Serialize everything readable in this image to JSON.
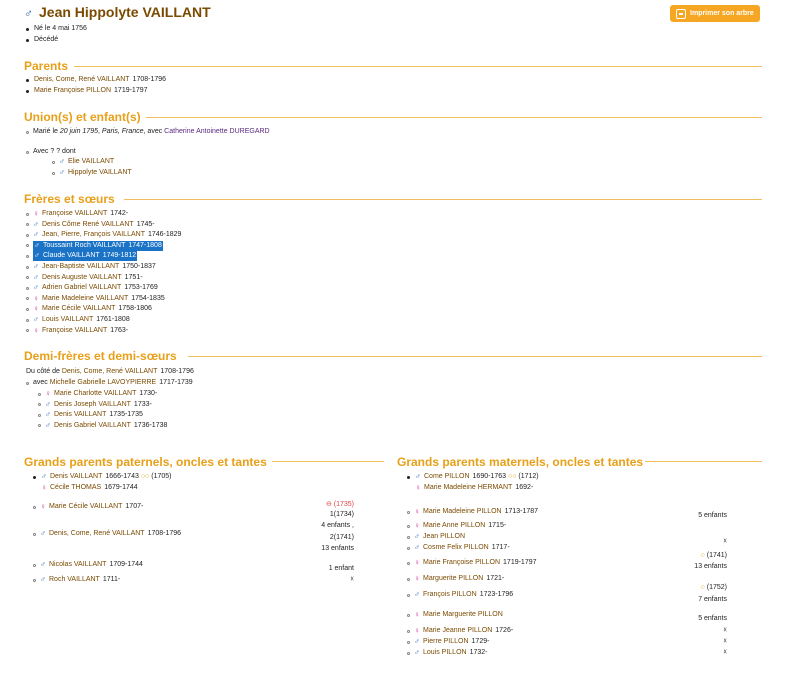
{
  "header": {
    "name": "Jean Hippolyte VAILLANT",
    "print_button": "Imprimer son arbre"
  },
  "facts": [
    "Né le 4 mai 1756",
    "Décédé"
  ],
  "parents": {
    "title": "Parents",
    "items": [
      {
        "name": "Denis, Come, René VAILLANT",
        "years": "1708-1796"
      },
      {
        "name": "Marie Françoise PILLON",
        "years": "1719-1797"
      }
    ]
  },
  "unions": {
    "title": "Union(s) et enfant(s)",
    "marriage_prefix": "Marié le",
    "marriage_date": "20 juin 1795",
    "marriage_place": "Paris, France",
    "marriage_with": ", avec",
    "spouse": "Catherine Antoinette DUREGARD",
    "other_union": "Avec ? ? dont",
    "children": [
      "Elie VAILLANT",
      "Hippolyte VAILLANT"
    ]
  },
  "siblings": {
    "title": "Frères et sœurs",
    "items": [
      {
        "sex": "f",
        "name": "Françoise VAILLANT",
        "years": "1742-"
      },
      {
        "sex": "m",
        "name": "Denis Côme René VAILLANT",
        "years": "1745-"
      },
      {
        "sex": "m",
        "name": "Jean, Pierre, François VAILLANT",
        "years": "1746-1829"
      },
      {
        "sex": "m",
        "name": "Toussaint Roch VAILLANT",
        "years": "1747-1808"
      },
      {
        "sex": "m",
        "name": "Claude VAILLANT",
        "years": "1749-1812"
      },
      {
        "sex": "m",
        "name": "Jean-Baptiste VAILLANT",
        "years": "1750-1837"
      },
      {
        "sex": "m",
        "name": "Denis Auguste VAILLANT",
        "years": "1751-"
      },
      {
        "sex": "m",
        "name": "Adrien Gabriel VAILLANT",
        "years": "1753-1769"
      },
      {
        "sex": "f",
        "name": "Marie Madeleine VAILLANT",
        "years": "1754-1835"
      },
      {
        "sex": "f",
        "name": "Marie Cécile VAILLANT",
        "years": "1758-1806"
      },
      {
        "sex": "m",
        "name": "Louis VAILLANT",
        "years": "1761-1808"
      },
      {
        "sex": "f",
        "name": "Françoise VAILLANT",
        "years": "1763-"
      }
    ]
  },
  "half_siblings": {
    "title": "Demi-frères et demi-sœurs",
    "side_prefix": "Du côté de",
    "side_parent": "Denis, Come, René VAILLANT",
    "side_years": "1708-1796",
    "with_prefix": "avec",
    "with_name": "Michelle Gabrielle LAVOYPIERRE",
    "with_years": "1717-1739",
    "items": [
      {
        "sex": "f",
        "name": "Marie Charlotte VAILLANT",
        "years": "1730-"
      },
      {
        "sex": "m",
        "name": "Denis Joseph VAILLANT",
        "years": "1733-"
      },
      {
        "sex": "m",
        "name": "Denis VAILLANT",
        "years": "1735-1735"
      },
      {
        "sex": "m",
        "name": "Denis Gabriel VAILLANT",
        "years": "1736-1738"
      }
    ]
  },
  "paternal": {
    "title": "Grands parents paternels, oncles et tantes",
    "grandparents": [
      {
        "sex": "m",
        "name": "Denis VAILLANT",
        "years": "1666-1743",
        "note": "(1705)"
      },
      {
        "sex": "f",
        "name": "Cécile THOMAS",
        "years": "1679-1744"
      }
    ],
    "items": [
      {
        "sex": "f",
        "name": "Marie Cécile VAILLANT",
        "years": "1707-",
        "right": [
          "⊖ (1735)",
          "1(1734)",
          "4 enfants ,"
        ]
      },
      {
        "sex": "m",
        "name": "Denis, Come, René VAILLANT",
        "years": "1708-1796",
        "right": [
          "2(1741)",
          "13 enfants"
        ]
      },
      {
        "sex": "m",
        "name": "Nicolas VAILLANT",
        "years": "1709-1744",
        "right": [
          "1 enfant"
        ]
      },
      {
        "sex": "m",
        "name": "Roch VAILLANT",
        "years": "1711-",
        "right": [
          "☓"
        ]
      }
    ]
  },
  "maternal": {
    "title": "Grands parents maternels, oncles et tantes",
    "grandparents": [
      {
        "sex": "m",
        "name": "Come PILLON",
        "years": "1690-1763",
        "note": "(1712)"
      },
      {
        "sex": "f",
        "name": "Marie Madeleine HERMANT",
        "years": "1692-"
      }
    ],
    "items": [
      {
        "sex": "f",
        "name": "Marie Madeleine PILLON",
        "years": "1713-1787",
        "right": "5 enfants"
      },
      {
        "sex": "f",
        "name": "Marie Anne PILLON",
        "years": "1715-",
        "right": ""
      },
      {
        "sex": "m",
        "name": "Jean PILLON",
        "years": "",
        "right": "☓"
      },
      {
        "sex": "m",
        "name": "Cosme Felix PILLON",
        "years": "1717-",
        "right": ""
      },
      {
        "sex": "f",
        "name": "Marie Françoise PILLON",
        "years": "1719-1797",
        "right": "13 enfants"
      },
      {
        "sex": "f",
        "name": "Marguerite PILLON",
        "years": "1721-",
        "right": ""
      },
      {
        "sex": "m",
        "name": "François PILLON",
        "years": "1723-1796",
        "right": "7 enfants"
      },
      {
        "sex": "f",
        "name": "Marie Marguerite PILLON",
        "years": "",
        "right": "5 enfants"
      },
      {
        "sex": "f",
        "name": "Marie Jeanne PILLON",
        "years": "1726-",
        "right": "☓"
      },
      {
        "sex": "m",
        "name": "Pierre PILLON",
        "years": "1729-",
        "right": "☓"
      },
      {
        "sex": "m",
        "name": "Louis PILLON",
        "years": "1732-",
        "right": "☓"
      }
    ],
    "notes": {
      "mf_year": "(1741)",
      "fp_year": "(1752)"
    }
  },
  "colors": {
    "accent": "#e8a01a",
    "link": "#7a4a00",
    "male": "#2b6ab8",
    "female": "#d0308a",
    "selection": "#1a73c6"
  }
}
